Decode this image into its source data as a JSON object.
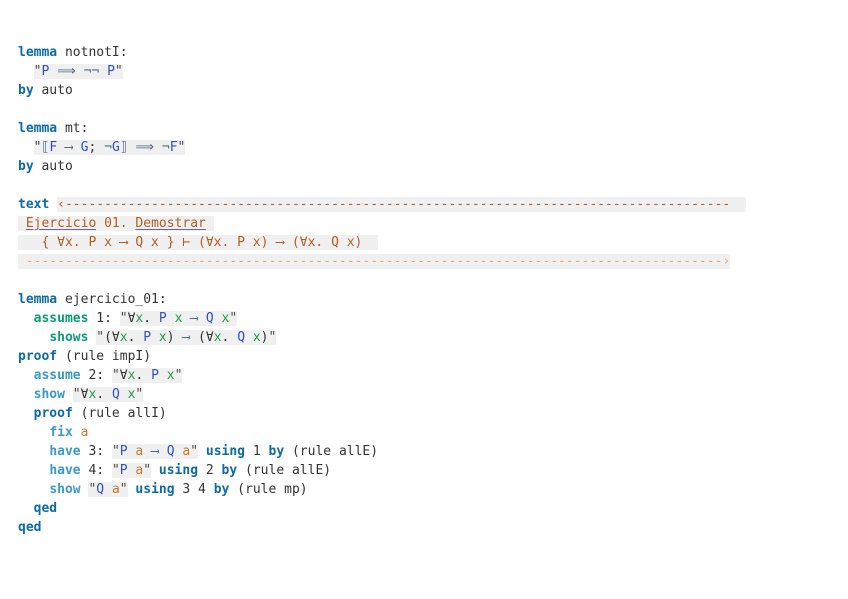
{
  "app": {
    "kind": "isabelle-theory-editor",
    "background": "#ffffff"
  },
  "palette": {
    "kw1": "#0e6aa4",
    "kw2": "#3a9ac9",
    "kw3": "#0b9c77",
    "plain": "#333333",
    "free": "#2e4ecf",
    "bound": "#23994e",
    "skolem": "#c9792f",
    "op": "#54687d",
    "quote": "#4a4a4a",
    "cart": "#b15e22",
    "cartdim": "#dcab82",
    "term_bg": "#f0f0f1",
    "spell_underline": "#6a5acd"
  },
  "editor": {
    "lines": [
      {
        "n": "line-lemma-notnotI",
        "segs": [
          {
            "t": "lemma",
            "c": "kw1"
          },
          {
            "t": " notnotI:"
          }
        ]
      },
      {
        "n": "line-notnotI-statement",
        "segs": [
          {
            "t": "  "
          },
          {
            "t": "\"",
            "c": "quote",
            "b": 1
          },
          {
            "t": "P",
            "c": "free",
            "b": 1
          },
          {
            "t": " ",
            "b": 1
          },
          {
            "t": "⟹",
            "c": "op",
            "b": 1
          },
          {
            "t": " ",
            "b": 1
          },
          {
            "t": "¬¬",
            "c": "op",
            "b": 1
          },
          {
            "t": " ",
            "b": 1
          },
          {
            "t": "P",
            "c": "free",
            "b": 1
          },
          {
            "t": "\"",
            "c": "quote",
            "b": 1
          }
        ]
      },
      {
        "n": "line-notnotI-by-auto",
        "segs": [
          {
            "t": "by",
            "c": "kw1"
          },
          {
            "t": " auto"
          }
        ]
      },
      {
        "n": "line-blank",
        "segs": []
      },
      {
        "n": "line-lemma-mt",
        "segs": [
          {
            "t": "lemma",
            "c": "kw1"
          },
          {
            "t": " mt:"
          }
        ]
      },
      {
        "n": "line-mt-statement",
        "segs": [
          {
            "t": "  "
          },
          {
            "t": "\"",
            "c": "quote",
            "b": 1
          },
          {
            "t": "⟦",
            "c": "op",
            "b": 1
          },
          {
            "t": "F",
            "c": "free",
            "b": 1
          },
          {
            "t": " ",
            "b": 1
          },
          {
            "t": "⟶",
            "c": "op",
            "b": 1
          },
          {
            "t": " ",
            "b": 1
          },
          {
            "t": "G",
            "c": "free",
            "b": 1
          },
          {
            "t": "; ",
            "b": 1
          },
          {
            "t": "¬",
            "c": "op",
            "b": 1
          },
          {
            "t": "G",
            "c": "free",
            "b": 1
          },
          {
            "t": "⟧",
            "c": "op",
            "b": 1
          },
          {
            "t": " ",
            "b": 1
          },
          {
            "t": "⟹",
            "c": "op",
            "b": 1
          },
          {
            "t": " ",
            "b": 1
          },
          {
            "t": "¬",
            "c": "op",
            "b": 1
          },
          {
            "t": "F",
            "c": "free",
            "b": 1
          },
          {
            "t": "\"",
            "c": "quote",
            "b": 1
          }
        ]
      },
      {
        "n": "line-mt-by-auto",
        "segs": [
          {
            "t": "by",
            "c": "kw1"
          },
          {
            "t": " auto"
          }
        ]
      },
      {
        "n": "line-blank",
        "segs": []
      },
      {
        "n": "line-text-open",
        "segs": [
          {
            "t": "text",
            "c": "kw1"
          },
          {
            "t": " "
          },
          {
            "t": "‹",
            "c": "cart",
            "b": 1
          },
          {
            "t": "-------------------------------------------------------------------------------------",
            "c": "cart",
            "b": 1
          },
          {
            "t": "  ",
            "b": 1
          }
        ]
      },
      {
        "n": "line-text-title",
        "segs": [
          {
            "t": " ",
            "b": 1
          },
          {
            "t": "Ejercicio",
            "c": "cart",
            "b": 1,
            "u": 1
          },
          {
            "t": " 01. ",
            "c": "cart",
            "b": 1
          },
          {
            "t": "Demostrar",
            "c": "cart",
            "b": 1,
            "u": 1
          },
          {
            "t": " ",
            "b": 1
          }
        ]
      },
      {
        "n": "line-text-formula",
        "segs": [
          {
            "t": "   { ∀x. P x ⟶ Q x } ⊢ (∀x. P x) ⟶ (∀x. Q x)  ",
            "c": "cart",
            "b": 1
          }
        ]
      },
      {
        "n": "line-text-close",
        "segs": [
          {
            "t": " ",
            "b": 1
          },
          {
            "t": "-----------------------------------------------------------------------------------------",
            "c": "cartdim",
            "b": 1
          },
          {
            "t": "›",
            "c": "cartdim",
            "b": 1
          }
        ]
      },
      {
        "n": "line-blank",
        "segs": []
      },
      {
        "n": "line-lemma-ejercicio-01",
        "segs": [
          {
            "t": "lemma",
            "c": "kw1"
          },
          {
            "t": " ejercicio_01:"
          }
        ]
      },
      {
        "n": "line-assumes-1",
        "segs": [
          {
            "t": "  "
          },
          {
            "t": "assumes",
            "c": "kw3"
          },
          {
            "t": " 1: "
          },
          {
            "t": "\"",
            "c": "quote",
            "b": 1
          },
          {
            "t": "∀",
            "b": 1
          },
          {
            "t": "x",
            "c": "bound",
            "b": 1
          },
          {
            "t": ". ",
            "b": 1
          },
          {
            "t": "P",
            "c": "free",
            "b": 1
          },
          {
            "t": " ",
            "b": 1
          },
          {
            "t": "x",
            "c": "bound",
            "b": 1
          },
          {
            "t": " ",
            "b": 1
          },
          {
            "t": "⟶",
            "c": "op",
            "b": 1
          },
          {
            "t": " ",
            "b": 1
          },
          {
            "t": "Q",
            "c": "free",
            "b": 1
          },
          {
            "t": " ",
            "b": 1
          },
          {
            "t": "x",
            "c": "bound",
            "b": 1
          },
          {
            "t": "\"",
            "c": "quote",
            "b": 1
          }
        ]
      },
      {
        "n": "line-shows",
        "segs": [
          {
            "t": "    "
          },
          {
            "t": "shows",
            "c": "kw3"
          },
          {
            "t": " "
          },
          {
            "t": "\"",
            "c": "quote",
            "b": 1
          },
          {
            "t": "(∀",
            "b": 1
          },
          {
            "t": "x",
            "c": "bound",
            "b": 1
          },
          {
            "t": ". ",
            "b": 1
          },
          {
            "t": "P",
            "c": "free",
            "b": 1
          },
          {
            "t": " ",
            "b": 1
          },
          {
            "t": "x",
            "c": "bound",
            "b": 1
          },
          {
            "t": ") ",
            "b": 1
          },
          {
            "t": "⟶",
            "c": "op",
            "b": 1
          },
          {
            "t": " (∀",
            "b": 1
          },
          {
            "t": "x",
            "c": "bound",
            "b": 1
          },
          {
            "t": ". ",
            "b": 1
          },
          {
            "t": "Q",
            "c": "free",
            "b": 1
          },
          {
            "t": " ",
            "b": 1
          },
          {
            "t": "x",
            "c": "bound",
            "b": 1
          },
          {
            "t": ")",
            "b": 1
          },
          {
            "t": "\"",
            "c": "quote",
            "b": 1
          }
        ]
      },
      {
        "n": "line-proof-impI",
        "segs": [
          {
            "t": "proof",
            "c": "kw1"
          },
          {
            "t": " (rule impI)"
          }
        ]
      },
      {
        "n": "line-assume-2",
        "segs": [
          {
            "t": "  "
          },
          {
            "t": "assume",
            "c": "kw2"
          },
          {
            "t": " 2: "
          },
          {
            "t": "\"",
            "c": "quote",
            "b": 1
          },
          {
            "t": "∀",
            "b": 1
          },
          {
            "t": "x",
            "c": "bound",
            "b": 1
          },
          {
            "t": ". ",
            "b": 1
          },
          {
            "t": "P",
            "c": "free",
            "b": 1
          },
          {
            "t": " ",
            "b": 1
          },
          {
            "t": "x",
            "c": "bound",
            "b": 1
          },
          {
            "t": "\"",
            "c": "quote",
            "b": 1
          }
        ]
      },
      {
        "n": "line-show-all-Q",
        "segs": [
          {
            "t": "  "
          },
          {
            "t": "show",
            "c": "kw2"
          },
          {
            "t": " "
          },
          {
            "t": "\"",
            "c": "quote",
            "b": 1
          },
          {
            "t": "∀",
            "b": 1
          },
          {
            "t": "x",
            "c": "bound",
            "b": 1
          },
          {
            "t": ". ",
            "b": 1
          },
          {
            "t": "Q",
            "c": "free",
            "b": 1
          },
          {
            "t": " ",
            "b": 1
          },
          {
            "t": "x",
            "c": "bound",
            "b": 1
          },
          {
            "t": "\"",
            "c": "quote",
            "b": 1
          }
        ]
      },
      {
        "n": "line-proof-allI",
        "segs": [
          {
            "t": "  "
          },
          {
            "t": "proof",
            "c": "kw1"
          },
          {
            "t": " (rule allI)"
          }
        ]
      },
      {
        "n": "line-fix-a",
        "segs": [
          {
            "t": "    "
          },
          {
            "t": "fix",
            "c": "kw2"
          },
          {
            "t": " "
          },
          {
            "t": "a",
            "c": "skolem"
          }
        ]
      },
      {
        "n": "line-have-3",
        "segs": [
          {
            "t": "    "
          },
          {
            "t": "have",
            "c": "kw2"
          },
          {
            "t": " 3: "
          },
          {
            "t": "\"",
            "c": "quote",
            "b": 1
          },
          {
            "t": "P",
            "c": "free",
            "b": 1
          },
          {
            "t": " ",
            "b": 1
          },
          {
            "t": "a",
            "c": "skolem",
            "b": 1
          },
          {
            "t": " ",
            "b": 1
          },
          {
            "t": "⟶",
            "c": "op",
            "b": 1
          },
          {
            "t": " ",
            "b": 1
          },
          {
            "t": "Q",
            "c": "free",
            "b": 1
          },
          {
            "t": " ",
            "b": 1
          },
          {
            "t": "a",
            "c": "skolem",
            "b": 1
          },
          {
            "t": "\"",
            "c": "quote",
            "b": 1
          },
          {
            "t": " "
          },
          {
            "t": "using",
            "c": "kw1"
          },
          {
            "t": " 1 "
          },
          {
            "t": "by",
            "c": "kw1"
          },
          {
            "t": " (rule allE)"
          }
        ]
      },
      {
        "n": "line-have-4",
        "segs": [
          {
            "t": "    "
          },
          {
            "t": "have",
            "c": "kw2"
          },
          {
            "t": " 4: "
          },
          {
            "t": "\"",
            "c": "quote",
            "b": 1
          },
          {
            "t": "P",
            "c": "free",
            "b": 1
          },
          {
            "t": " ",
            "b": 1
          },
          {
            "t": "a",
            "c": "skolem",
            "b": 1
          },
          {
            "t": "\"",
            "c": "quote",
            "b": 1
          },
          {
            "t": " "
          },
          {
            "t": "using",
            "c": "kw1"
          },
          {
            "t": " 2 "
          },
          {
            "t": "by",
            "c": "kw1"
          },
          {
            "t": " (rule allE)"
          }
        ]
      },
      {
        "n": "line-show-Q-a",
        "segs": [
          {
            "t": "    "
          },
          {
            "t": "show",
            "c": "kw2"
          },
          {
            "t": " "
          },
          {
            "t": "\"",
            "c": "quote",
            "b": 1
          },
          {
            "t": "Q",
            "c": "free",
            "b": 1
          },
          {
            "t": " ",
            "b": 1
          },
          {
            "t": "a",
            "c": "skolem",
            "b": 1
          },
          {
            "t": "\"",
            "c": "quote",
            "b": 1
          },
          {
            "t": " "
          },
          {
            "t": "using",
            "c": "kw1"
          },
          {
            "t": " 3 4 "
          },
          {
            "t": "by",
            "c": "kw1"
          },
          {
            "t": " (rule mp)"
          }
        ]
      },
      {
        "n": "line-qed-inner",
        "segs": [
          {
            "t": "  "
          },
          {
            "t": "qed",
            "c": "kw1"
          }
        ]
      },
      {
        "n": "line-qed-outer",
        "segs": [
          {
            "t": "qed",
            "c": "kw1"
          }
        ]
      }
    ]
  }
}
